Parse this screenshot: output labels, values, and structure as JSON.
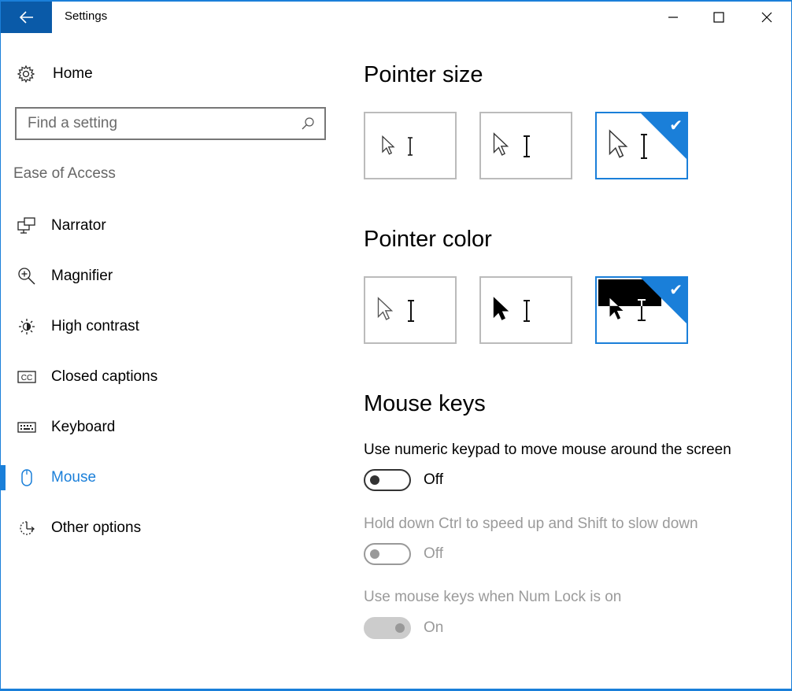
{
  "window": {
    "title": "Settings",
    "accent_color": "#1a7fd9",
    "back_button_color": "#0a5aa8",
    "controls": {
      "minimize": "minimize-icon",
      "maximize": "maximize-icon",
      "close": "close-icon"
    }
  },
  "sidebar": {
    "home_label": "Home",
    "search": {
      "placeholder": "Find a setting",
      "value": ""
    },
    "section_label": "Ease of Access",
    "items": [
      {
        "label": "Narrator",
        "icon": "narrator-icon",
        "active": false
      },
      {
        "label": "Magnifier",
        "icon": "magnifier-icon",
        "active": false
      },
      {
        "label": "High contrast",
        "icon": "high-contrast-icon",
        "active": false
      },
      {
        "label": "Closed captions",
        "icon": "closed-captions-icon",
        "active": false
      },
      {
        "label": "Keyboard",
        "icon": "keyboard-icon",
        "active": false
      },
      {
        "label": "Mouse",
        "icon": "mouse-icon",
        "active": true
      },
      {
        "label": "Other options",
        "icon": "other-options-icon",
        "active": false
      }
    ]
  },
  "main": {
    "pointer_size": {
      "heading": "Pointer size",
      "options": [
        "small",
        "medium",
        "large"
      ],
      "selected": "large"
    },
    "pointer_color": {
      "heading": "Pointer color",
      "options": [
        "white",
        "black",
        "inverted"
      ],
      "selected": "inverted"
    },
    "mouse_keys": {
      "heading": "Mouse keys",
      "settings": [
        {
          "description": "Use numeric keypad to move mouse around the screen",
          "state": "Off",
          "on": false,
          "enabled": true
        },
        {
          "description": "Hold down Ctrl to speed up and Shift to slow down",
          "state": "Off",
          "on": false,
          "enabled": false
        },
        {
          "description": "Use mouse keys when Num Lock is on",
          "state": "On",
          "on": true,
          "enabled": false
        }
      ]
    }
  }
}
